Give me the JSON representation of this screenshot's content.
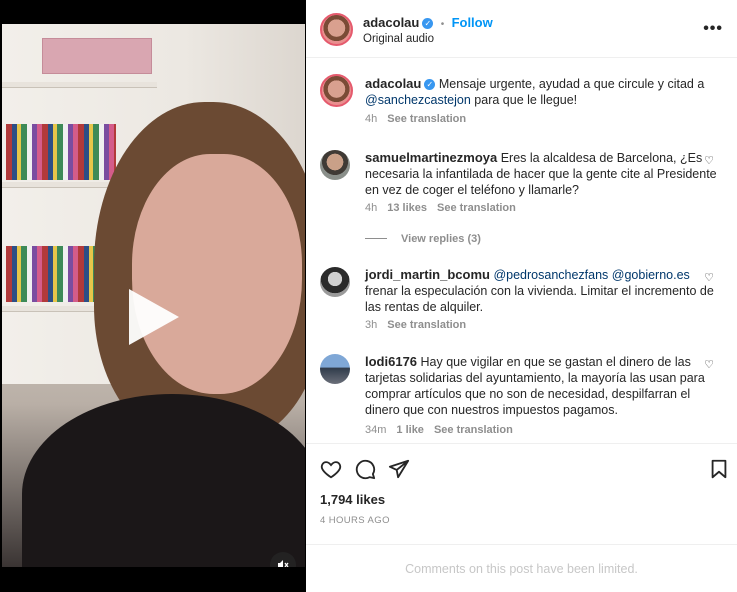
{
  "post": {
    "username": "adacolau",
    "dot": "•",
    "follow_label": "Follow",
    "audio": "Original audio",
    "more_label": "•••"
  },
  "caption": {
    "username": "adacolau",
    "text": "Mensaje urgente, ayudad a que circule y citad a",
    "mention": "@sanchezcastejon",
    "text_end": "para que le llegue!",
    "time": "4h",
    "see_translation": "See translation"
  },
  "comments": [
    {
      "username": "samuelmartinezmoya",
      "text": "Eres la alcaldesa de Barcelona, ¿Es necesaria la infantilada de hacer que la gente cite al Presidente en vez de coger el teléfono y llamarle?",
      "time": "4h",
      "likes": "13 likes",
      "see_translation": "See translation"
    },
    {
      "username": "jordi_martin_bcomu",
      "mention1": "@pedrosanchezfans",
      "mention2": "@gobierno.es",
      "text": "frenar la especulación con la vivienda. Limitar el incremento de las rentas de alquiler.",
      "time": "3h",
      "see_translation": "See translation"
    },
    {
      "username": "lodi6176",
      "text": "Hay que vigilar en que se gastan el dinero de las tarjetas solidarias del ayuntamiento, la mayoría las usan para comprar artículos que no son de necesidad, despilfarran el dinero que con nuestros impuestos pagamos.",
      "time": "34m",
      "likes": "1 like",
      "see_translation": "See translation"
    }
  ],
  "view_replies": "View replies (3)",
  "footer": {
    "likes": "1,794 likes",
    "time_ago": "4 HOURS AGO",
    "limited": "Comments on this post have been limited."
  },
  "icons": [
    "heart-icon",
    "comment-icon",
    "share-icon",
    "bookmark-icon",
    "mute-icon",
    "play-icon",
    "verified-icon",
    "more-icon"
  ],
  "colors": {
    "follow": "#0095f6",
    "verified": "#3897f0",
    "mention": "#00376b",
    "muted": "#8e8e8e"
  }
}
